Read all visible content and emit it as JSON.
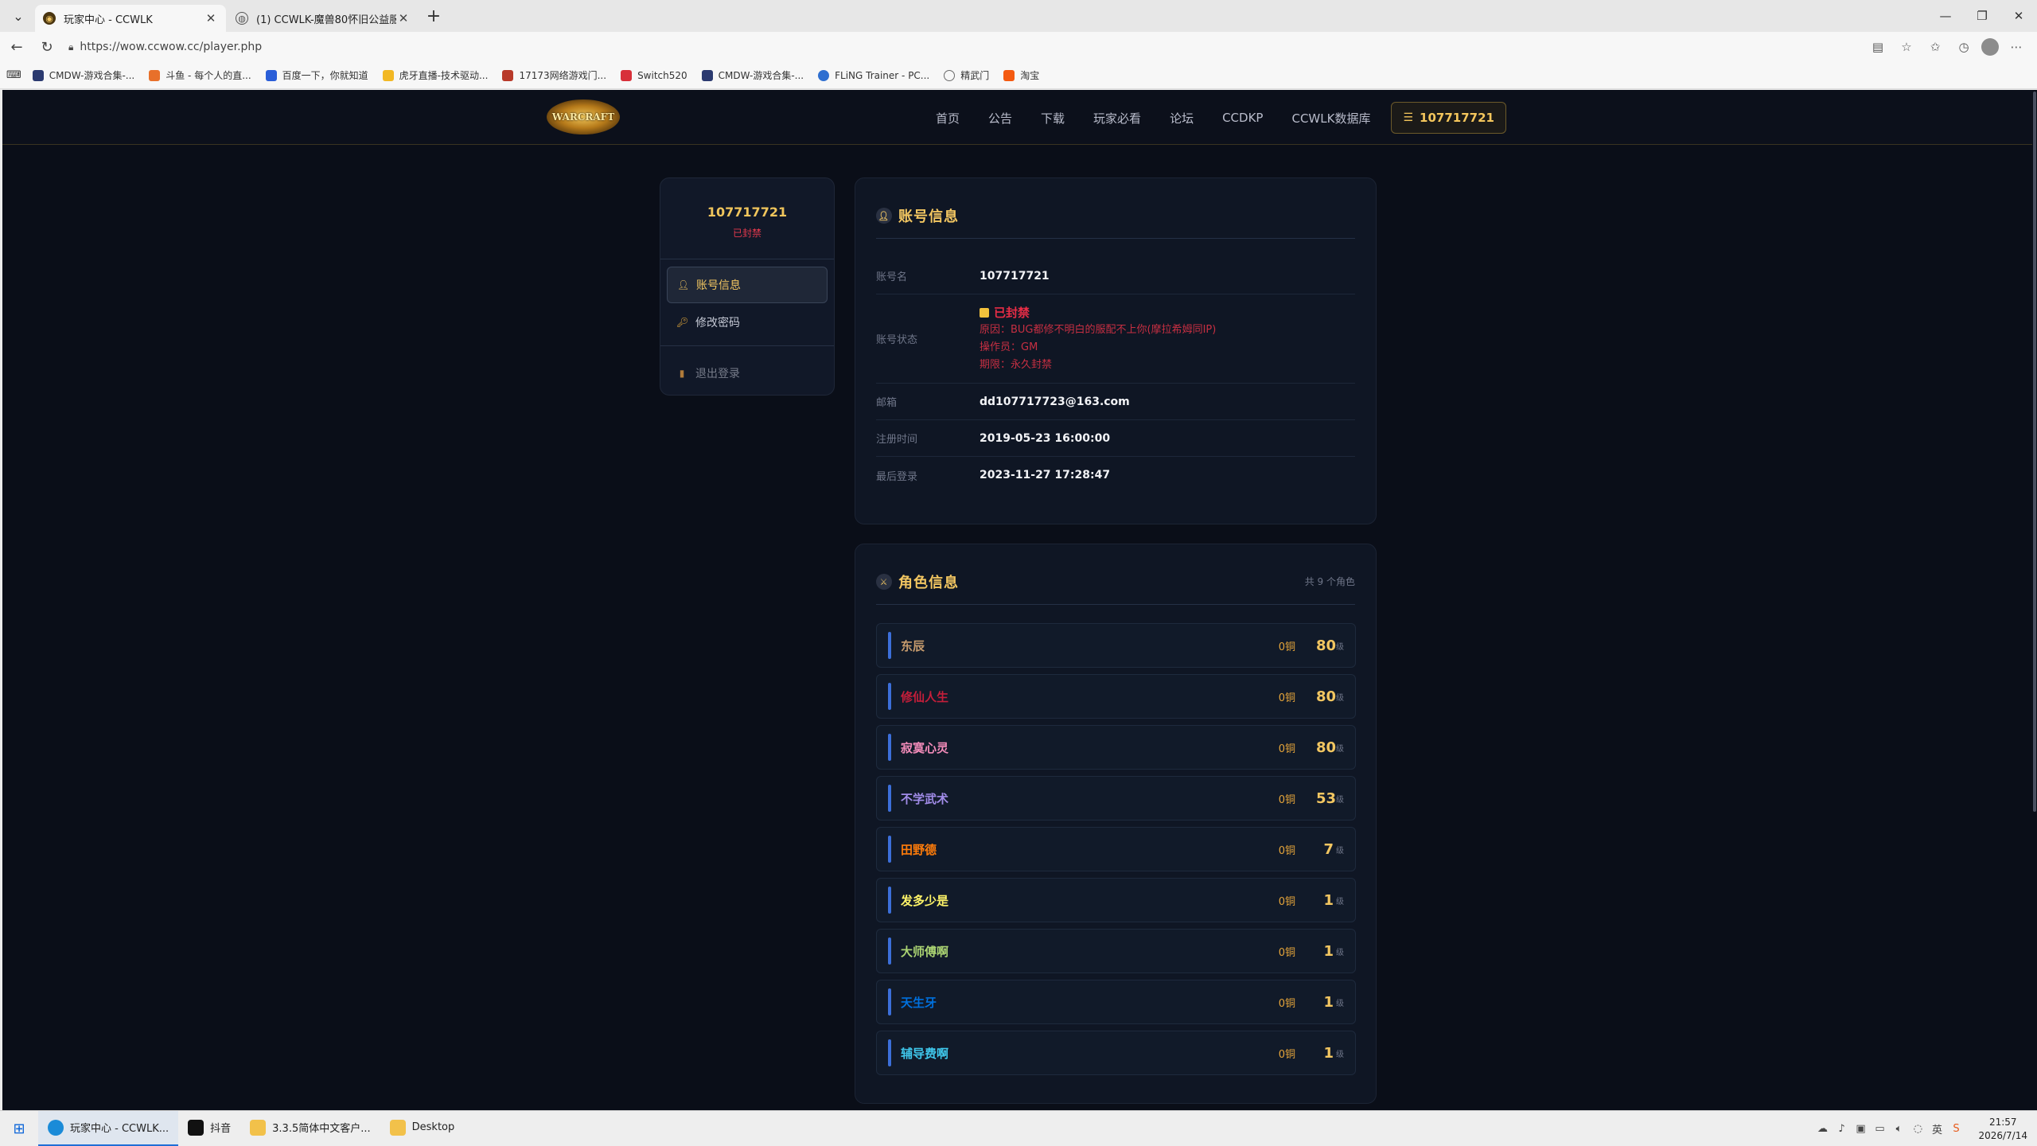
{
  "browser": {
    "tabs": [
      {
        "title": "玩家中心 - CCWLK",
        "active": true
      },
      {
        "title": "(1) CCWLK-魔兽80怀旧公益服论坛",
        "active": false
      }
    ],
    "url": "https://wow.ccwow.cc/player.php",
    "bookmarks": [
      {
        "label": "CMDW-游戏合集-...",
        "color": "#2b3a70"
      },
      {
        "label": "斗鱼 - 每个人的直...",
        "color": "#e8702a"
      },
      {
        "label": "百度一下，你就知道",
        "color": "#2a5ed8"
      },
      {
        "label": "虎牙直播-技术驱动...",
        "color": "#f2b824"
      },
      {
        "label": "17173网络游戏门...",
        "color": "#b83a2a"
      },
      {
        "label": "Switch520",
        "color": "#d8303a"
      },
      {
        "label": "CMDW-游戏合集-...",
        "color": "#2b3a70"
      },
      {
        "label": "FLiNG Trainer - PC...",
        "color": "#2f6fd0"
      },
      {
        "label": "精武门",
        "color": "#6a6a6a"
      },
      {
        "label": "淘宝",
        "color": "#f45a10"
      }
    ]
  },
  "site": {
    "logo_text": "WARCRAFT",
    "nav": [
      "首页",
      "公告",
      "下载",
      "玩家必看",
      "论坛",
      "CCDKP",
      "CCWLK数据库"
    ],
    "user_button": "107717721"
  },
  "sidebar": {
    "username": "107717721",
    "status": "已封禁",
    "items": [
      {
        "label": "账号信息",
        "icon": "user-icon",
        "active": true
      },
      {
        "label": "修改密码",
        "icon": "key-icon",
        "active": false
      },
      {
        "label": "退出登录",
        "icon": "door-icon",
        "active": false
      }
    ]
  },
  "account": {
    "title": "账号信息",
    "name_label": "账号名",
    "name_value": "107717721",
    "status_label": "账号状态",
    "ban_title": "已封禁",
    "ban_reason": "原因：BUG都修不明白的服配不上你(摩拉希姆同IP)",
    "ban_operator": "操作员：GM",
    "ban_duration": "期限：永久封禁",
    "email_label": "邮箱",
    "email_value": "dd107717723@163.com",
    "reg_label": "注册时间",
    "reg_value": "2019-05-23 16:00:00",
    "last_label": "最后登录",
    "last_value": "2023-11-27 17:28:47"
  },
  "characters": {
    "title": "角色信息",
    "count": "共 9 个角色",
    "level_unit": "级",
    "list": [
      {
        "name": "东辰",
        "gold": "0铜",
        "level": "80",
        "color": "#c69b6d"
      },
      {
        "name": "修仙人生",
        "gold": "0铜",
        "level": "80",
        "color": "#c41e3a"
      },
      {
        "name": "寂寞心灵",
        "gold": "0铜",
        "level": "80",
        "color": "#f48cba"
      },
      {
        "name": "不学武术",
        "gold": "0铜",
        "level": "53",
        "color": "#a18ce8"
      },
      {
        "name": "田野德",
        "gold": "0铜",
        "level": "7",
        "color": "#ff7c0a"
      },
      {
        "name": "发多少是",
        "gold": "0铜",
        "level": "1",
        "color": "#fff468"
      },
      {
        "name": "大师傅啊",
        "gold": "0铜",
        "level": "1",
        "color": "#aad372"
      },
      {
        "name": "天生牙",
        "gold": "0铜",
        "level": "1",
        "color": "#0070dd"
      },
      {
        "name": "辅导费啊",
        "gold": "0铜",
        "level": "1",
        "color": "#3fc7eb"
      }
    ]
  },
  "taskbar": {
    "items": [
      {
        "label": "玩家中心 - CCWLK...",
        "color": "#1a8bd8",
        "active": true
      },
      {
        "label": "抖音",
        "color": "#111111",
        "active": false
      },
      {
        "label": "3.3.5简体中文客户...",
        "color": "#f2c14a",
        "active": false
      },
      {
        "label": "Desktop",
        "color": "#f2c14a",
        "active": false
      }
    ],
    "time": "21:57",
    "date": "2026/7/14"
  }
}
